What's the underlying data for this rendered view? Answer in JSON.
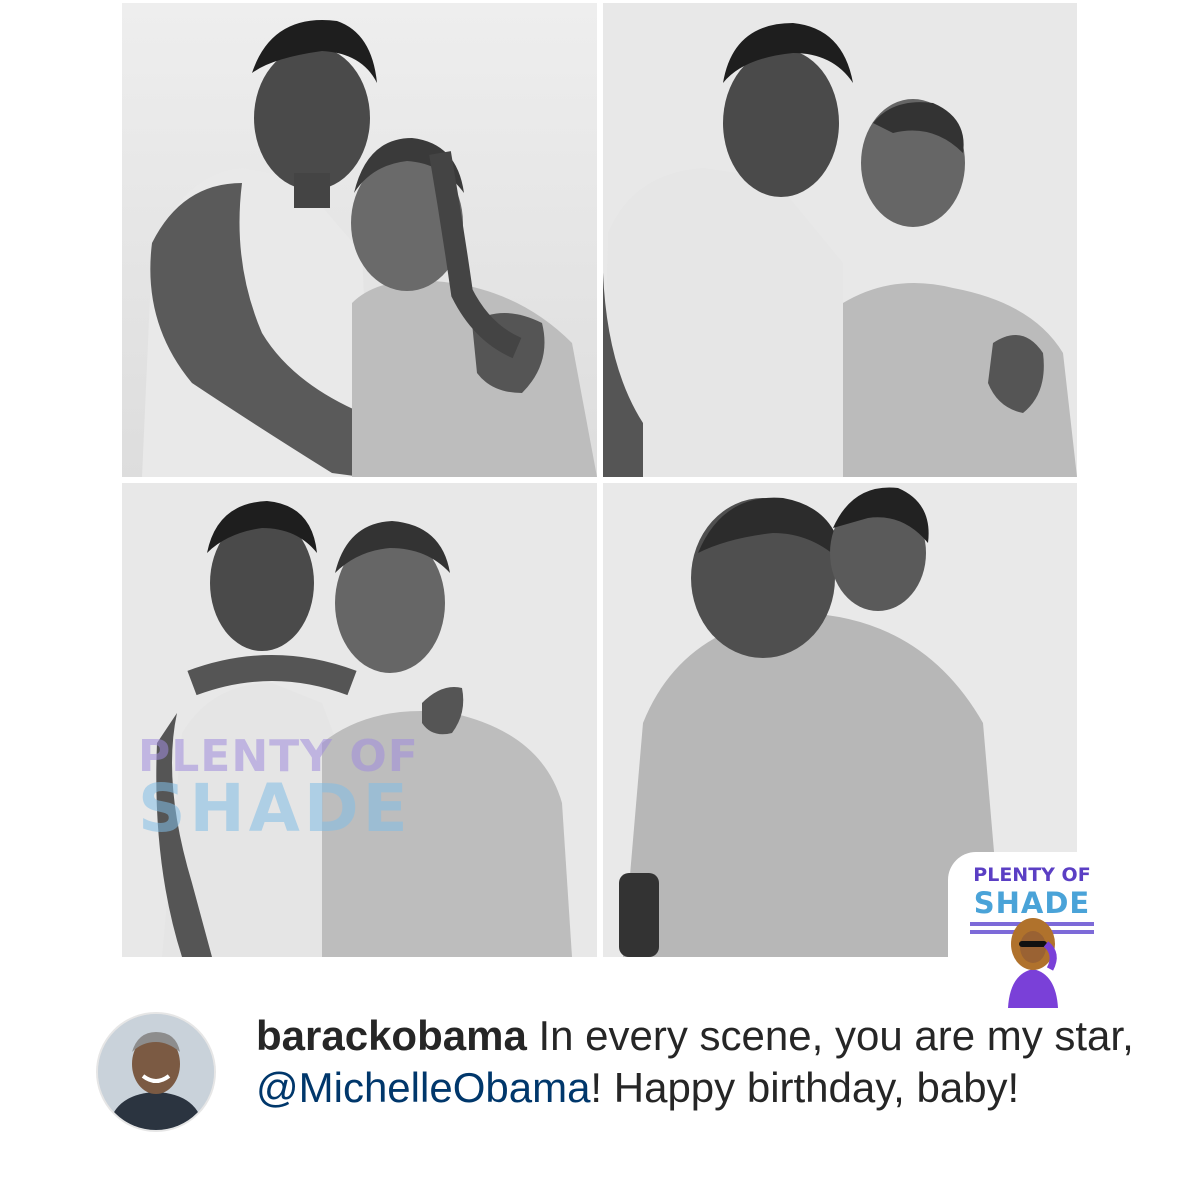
{
  "post": {
    "photos": [
      {
        "label": "couple-embrace-photo"
      },
      {
        "label": "couple-cheek-kiss-photo"
      },
      {
        "label": "couple-peace-sign-photo"
      },
      {
        "label": "couple-hug-photo"
      }
    ],
    "watermark": {
      "line1": "PLENTY OF",
      "line2": "SHADE"
    },
    "badge": {
      "line1": "PLENTY OF",
      "line2": "SHADE",
      "colors": {
        "purple": "#5b3fc4",
        "blue": "#4aa3d8"
      }
    },
    "caption": {
      "username": "barackobama",
      "text_before_mention": " In every scene, you are my star, ",
      "mention": "@MichelleObama",
      "text_after_mention": "! Happy birthday, baby!"
    },
    "colors": {
      "text": "#262626",
      "mention": "#00376b",
      "background": "#ffffff"
    }
  }
}
